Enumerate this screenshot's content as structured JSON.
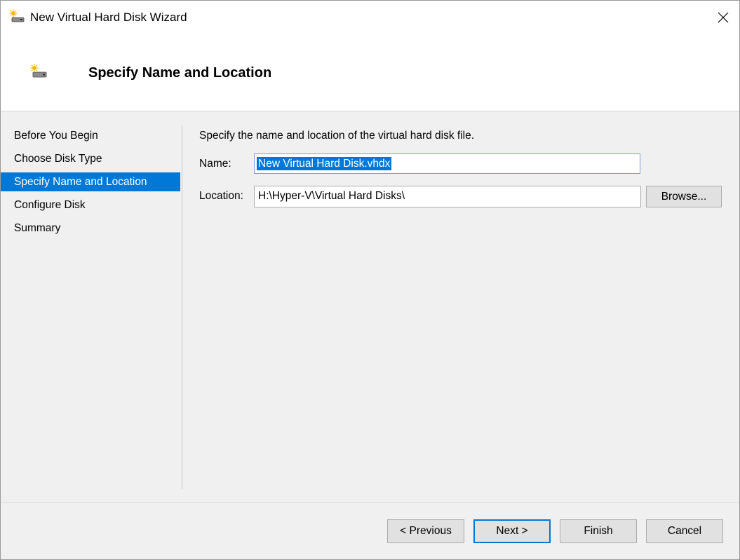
{
  "window": {
    "title": "New Virtual Hard Disk Wizard"
  },
  "header": {
    "title": "Specify Name and Location"
  },
  "nav": {
    "items": [
      {
        "label": "Before You Begin"
      },
      {
        "label": "Choose Disk Type"
      },
      {
        "label": "Specify Name and Location"
      },
      {
        "label": "Configure Disk"
      },
      {
        "label": "Summary"
      }
    ],
    "active_index": 2
  },
  "main": {
    "description": "Specify the name and location of the virtual hard disk file.",
    "name_label": "Name:",
    "name_value": "New Virtual Hard Disk.vhdx",
    "location_label": "Location:",
    "location_value": "H:\\Hyper-V\\Virtual Hard Disks\\",
    "browse_label": "Browse..."
  },
  "footer": {
    "previous_label": "< Previous",
    "next_label": "Next >",
    "finish_label": "Finish",
    "cancel_label": "Cancel"
  },
  "icons": {
    "title_icon": "disk-wizard-icon",
    "header_icon": "disk-wizard-icon",
    "close_icon": "close-icon"
  },
  "colors": {
    "accent": "#0078d7",
    "header_background": "#ffffff",
    "body_background": "#f0f0f0"
  }
}
